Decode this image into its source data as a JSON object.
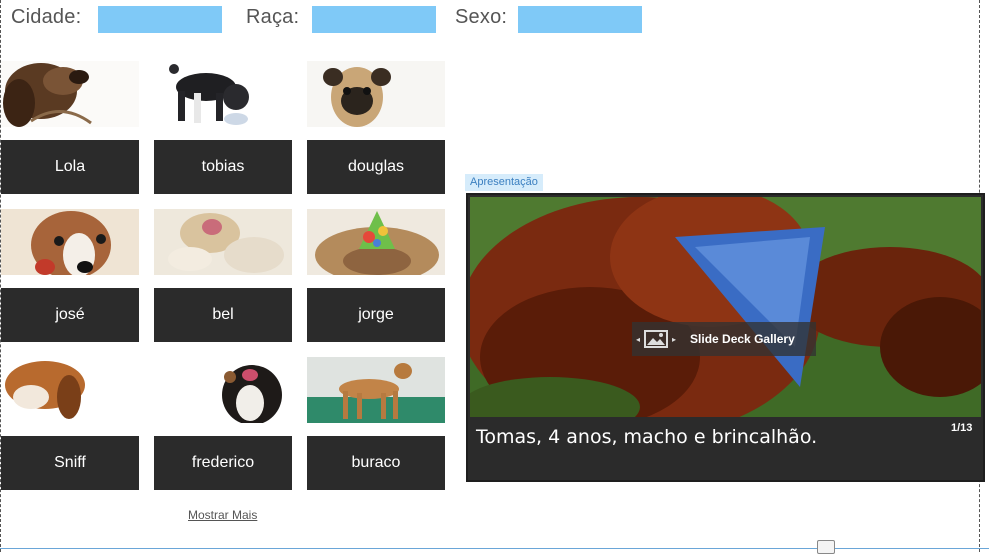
{
  "filters": {
    "city_label": "Cidade:",
    "breed_label": "Raça:",
    "sex_label": "Sexo:"
  },
  "dogs": [
    {
      "name": "Lola",
      "image_icon": "long-eared-dog-photo"
    },
    {
      "name": "tobias",
      "image_icon": "black-white-dog-photo"
    },
    {
      "name": "douglas",
      "image_icon": "pug-photo"
    },
    {
      "name": "josé",
      "image_icon": "brown-white-dog-photo"
    },
    {
      "name": "bel",
      "image_icon": "puppy-lying-photo"
    },
    {
      "name": "jorge",
      "image_icon": "bulldog-party-hat-photo"
    },
    {
      "name": "Sniff",
      "image_icon": "beagle-sniffing-photo"
    },
    {
      "name": "frederico",
      "image_icon": "tricolor-dog-photo"
    },
    {
      "name": "buraco",
      "image_icon": "tan-dog-standing-photo"
    }
  ],
  "more_link": "Mostrar Mais",
  "slideshow": {
    "tag": "Apresentação",
    "badge_title": "Slide Deck Gallery",
    "caption": "Tomas, 4 anos, macho e brincalhão.",
    "counter": "1/13"
  },
  "colors": {
    "input_fill": "#7fc9f7",
    "button_dark": "#2b2b2b",
    "tag_bg": "#d6ecfb"
  }
}
